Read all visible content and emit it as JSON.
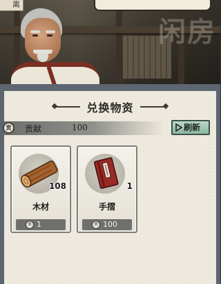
{
  "scene": {
    "left_tab_text": "离",
    "background_calligraphy": "闲房"
  },
  "exchange": {
    "title": "兑换物资",
    "currency": {
      "icon_char": "贡",
      "label": "贡献",
      "value": "100"
    },
    "refresh_label": "刷新",
    "items": [
      {
        "name": "木材",
        "icon": "wood-log-icon",
        "quantity": "108",
        "price": "1",
        "price_icon_char": "贡"
      },
      {
        "name": "手摺",
        "icon": "book-icon",
        "quantity": "1",
        "price": "100",
        "price_icon_char": "贡"
      }
    ]
  },
  "colors": {
    "panel_border": "#5d6570",
    "refresh_button": "#a6c8b7",
    "robe_trim": "#7b2f22"
  }
}
